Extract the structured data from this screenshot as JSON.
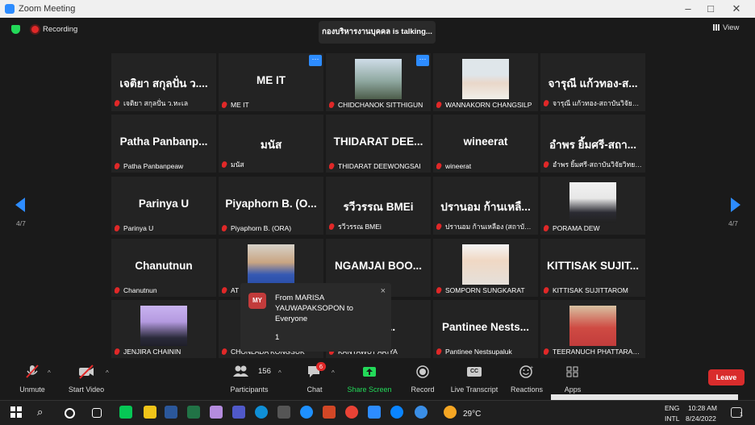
{
  "window": {
    "title": "Zoom Meeting"
  },
  "meeting": {
    "recording_label": "Recording",
    "talking": "กองบริหารงานบุคคล is talking...",
    "view_label": "View",
    "page_indicator": "4/7"
  },
  "tiles": [
    {
      "big": "เจติยา สกุลปั่น ว....",
      "name": "เจติยา สกุลปั่น ว.หะเล"
    },
    {
      "big": "ME IT",
      "name": "ME IT"
    },
    {
      "big": "",
      "name": "CHIDCHANOK SITTHIGUN"
    },
    {
      "big": "",
      "name": "WANNAKORN CHANGSILP"
    },
    {
      "big": "จารุณี แก้วทอง-ส...",
      "name": "จารุณี แก้วทอง-สถาบันวิจัยวิทยา..."
    },
    {
      "big": "Patha Panbanp...",
      "name": "Patha Panbanpeaw"
    },
    {
      "big": "มนัส",
      "name": "มนัส"
    },
    {
      "big": "THIDARAT DEE...",
      "name": "THIDARAT DEEWONGSAI"
    },
    {
      "big": "wineerat",
      "name": "wineerat"
    },
    {
      "big": "อำพร ยิ้มศรี-สถา...",
      "name": "อำพร ยิ้มศรี-สถาบันวิจัยวิทยา..."
    },
    {
      "big": "Parinya U",
      "name": "Parinya U"
    },
    {
      "big": "Piyaphorn B. (O...",
      "name": "Piyaphorn B. (ORA)"
    },
    {
      "big": "รวีวรรณ BMEi",
      "name": "รวีวรรณ BMEi"
    },
    {
      "big": "ปรานอม ก้านเหลื...",
      "name": "ปรานอม ก้านเหลือง (สถาบันวิ..."
    },
    {
      "big": "",
      "name": "PORAMA DEW"
    },
    {
      "big": "Chanutnun",
      "name": "Chanutnun"
    },
    {
      "big": "",
      "name": "AT"
    },
    {
      "big": "NGAMJAI BOO...",
      "name": "NRAHONG"
    },
    {
      "big": "",
      "name": "SOMPORN SUNGKARAT"
    },
    {
      "big": "KITTISAK SUJIT...",
      "name": "KITTISAK SUJITTAROM"
    },
    {
      "big": "",
      "name": "JENJIRA CHAININ"
    },
    {
      "big": "",
      "name": "CHONLADA KONGSUK"
    },
    {
      "big": "T AR...",
      "name": "KANYAWUT ARIYA"
    },
    {
      "big": "Pantinee Nests...",
      "name": "Pantinee Nestsupaluk"
    },
    {
      "big": "",
      "name": "TEERANUCH PHATTARAK..."
    }
  ],
  "chat_popup": {
    "avatar_initials": "MY",
    "from": "From MARISA YAUWAPAKSOPON to Everyone",
    "message": "1",
    "close": "×"
  },
  "toolbar": {
    "unmute": "Unmute",
    "start_video": "Start Video",
    "participants": "Participants",
    "participants_count": "156",
    "chat": "Chat",
    "chat_badge": "6",
    "share_screen": "Share Screen",
    "record": "Record",
    "live_transcript": "Live Transcript",
    "cc": "CC",
    "reactions": "Reactions",
    "apps": "Apps",
    "leave": "Leave"
  },
  "taskbar": {
    "temperature": "29°C",
    "lang_top": "ENG",
    "lang_bottom": "INTL",
    "time": "10:28 AM",
    "date": "8/24/2022",
    "notif_count": "1"
  },
  "colors": {
    "accent": "#2d8cff",
    "danger": "#e02828",
    "green": "#23d959",
    "tile_bg": "#232323"
  }
}
